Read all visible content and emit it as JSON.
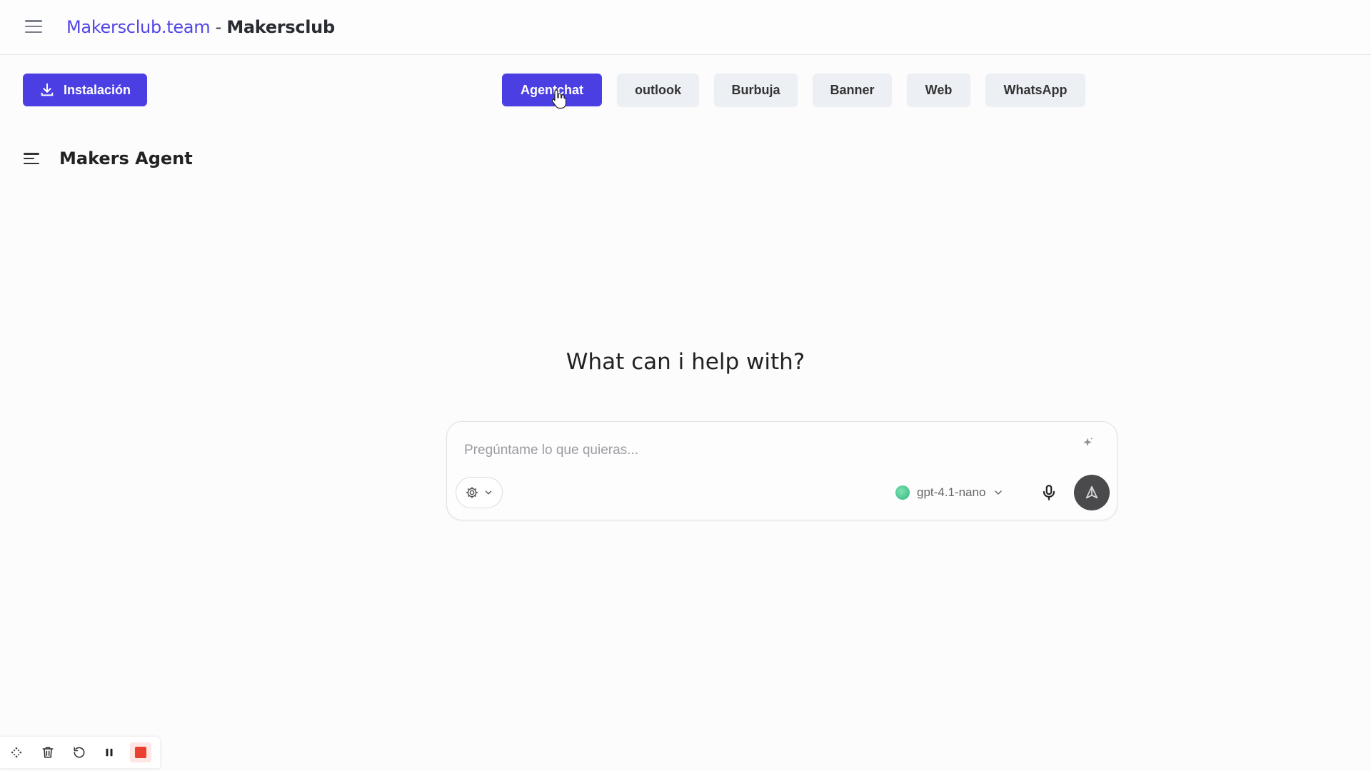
{
  "header": {
    "brand": "Makersclub.team",
    "separator": " - ",
    "workspace": "Makersclub"
  },
  "toolbar": {
    "install_label": "Instalación",
    "tabs": [
      {
        "label": "Agentchat",
        "active": true
      },
      {
        "label": "outlook",
        "active": false
      },
      {
        "label": "Burbuja",
        "active": false
      },
      {
        "label": "Banner",
        "active": false
      },
      {
        "label": "Web",
        "active": false
      },
      {
        "label": "WhatsApp",
        "active": false
      }
    ]
  },
  "agent": {
    "title": "Makers Agent"
  },
  "main": {
    "headline": "What can i help with?"
  },
  "composer": {
    "placeholder": "Pregúntame lo que quieras...",
    "value": "",
    "model": "gpt-4.1-nano"
  },
  "recorder": {
    "icons": [
      "move-icon",
      "trash-icon",
      "restart-icon",
      "pause-icon",
      "stop-icon"
    ]
  },
  "colors": {
    "accent": "#4b3fe4",
    "brand_text": "#5146e5",
    "tab_bg": "#eceff3",
    "send_bg": "#4a4a4d",
    "stop_red": "#e9402f",
    "model_dot": "#2fb982"
  }
}
